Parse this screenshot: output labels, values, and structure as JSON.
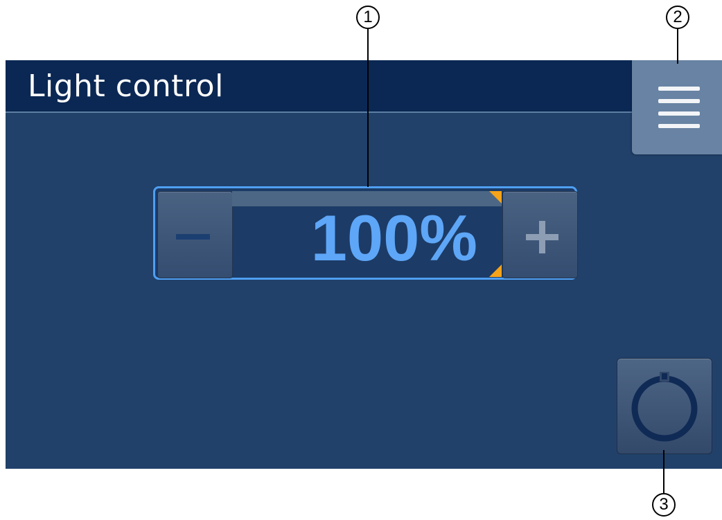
{
  "header": {
    "title": "Light control"
  },
  "menu": {
    "icon": "hamburger-menu-icon"
  },
  "dimmer": {
    "value_text": "100%",
    "level_percent": 100,
    "decrease_icon": "minus-icon",
    "increase_icon": "plus-icon",
    "accent_color": "#4f9ff2",
    "marker_color": "#f5a31a"
  },
  "power": {
    "icon": "power-icon"
  },
  "callouts": [
    "1",
    "2",
    "3"
  ],
  "colors": {
    "screen_background": "#21416a",
    "header_background": "#0b2854",
    "value_text": "#5ea6f7"
  }
}
